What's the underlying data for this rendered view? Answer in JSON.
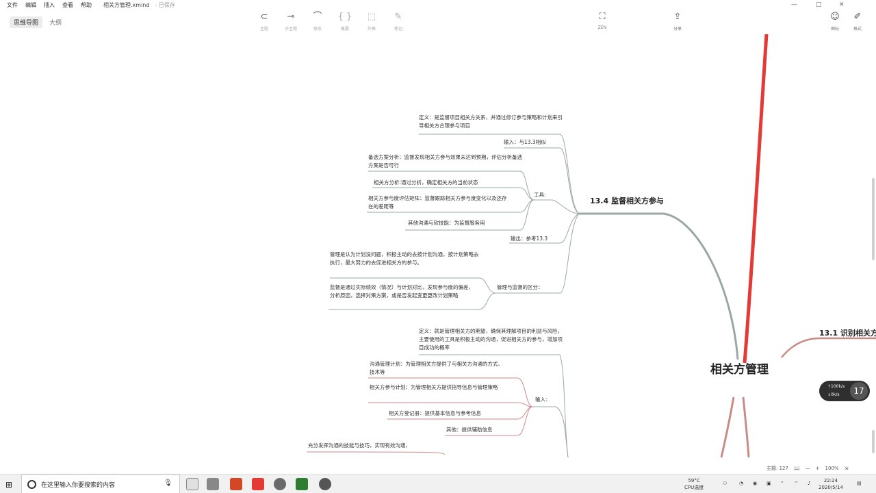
{
  "menu": {
    "items": [
      "文件",
      "编辑",
      "插入",
      "查看",
      "帮助"
    ],
    "doc_title": "相关方管理.xmind",
    "save_status": "- 已保存"
  },
  "view_tabs": [
    "思维导图",
    "大纲"
  ],
  "toolbar": {
    "tools": [
      {
        "icon": "topic-icon",
        "label": "主题"
      },
      {
        "icon": "subtopic-icon",
        "label": "子主题"
      },
      {
        "icon": "relationship-icon",
        "label": "联系"
      },
      {
        "icon": "summary-icon",
        "label": "概要"
      },
      {
        "icon": "boundary-icon",
        "label": "外框"
      },
      {
        "icon": "note-icon",
        "label": "笔记"
      }
    ],
    "zen": {
      "icon": "fullscreen-icon",
      "label": "ZEN"
    },
    "share": {
      "icon": "share-icon",
      "label": "分享"
    },
    "right": [
      {
        "icon": "smiley-icon",
        "label": "图标"
      },
      {
        "icon": "brush-icon",
        "label": "格式"
      }
    ]
  },
  "map": {
    "root": "相关方管理",
    "branch_134": "13.4 监督相关方参与",
    "branch_131": "13.1 识别相关方",
    "nodes_134": {
      "definition": "定义：是监督项目相关方关系，并通过修订参与策略和计划来引导相关方合理参与项目",
      "input": "输入：与13.3相似",
      "tools": "工具:",
      "tool_alt": "备选方案分析：监督发现相关方参与效果未达到预期，评估分析备选方案是否可行",
      "tool_analysis": "相关方分析:通过分析，确定相关方的当前状态",
      "tool_matrix": "相关方参与度评估矩阵：监督跟踪相关方参与度变化以及还存在的差距等",
      "tool_soft": "其他沟通与软技能：为监督服务用",
      "output": "输出：参考13.3",
      "diff": "管理与监督的区分：",
      "diff_manage": "管理是认为计划没问题，积极主动的去按计划沟通，按计划策略去执行，最大努力的去促进相关方的参与。",
      "diff_monitor": "监督是通过实际绩效（情况）与计划对比，发现参与度的偏差，分析原因，选择对策方案，或是否发起变更更改计划策略"
    },
    "nodes_133": {
      "definition": "定义：就是管理相关方的期望，确保其理解项目的利益与风险，主要使用的工具是积极主动的沟通，促进相关方的参与，增加项目成功的概率",
      "input": "输入：",
      "input_comm": "沟通管理计划：为管理相关方提供了与相关方沟通的方式、技术等",
      "input_engage": "相关方参与计划：为管理相关方提供指导信息与管理策略",
      "input_register": "相关方登记册：提供基本信息与参考信息",
      "input_other": "其他：提供辅助信息",
      "skills": "充分发挥沟通的技能与技巧，实现有效沟通，"
    }
  },
  "speed_widget": {
    "up": "↑100k/s",
    "down": "↓0k/s",
    "value": "17"
  },
  "status_bar": {
    "topics": "主题: 127",
    "zoom": "100%"
  },
  "taskbar": {
    "search_placeholder": "在这里输入你要搜索的内容",
    "weather_temp": "59°C",
    "weather_desc": "CPU温度",
    "time": "22:24",
    "date": "2020/5/14"
  }
}
